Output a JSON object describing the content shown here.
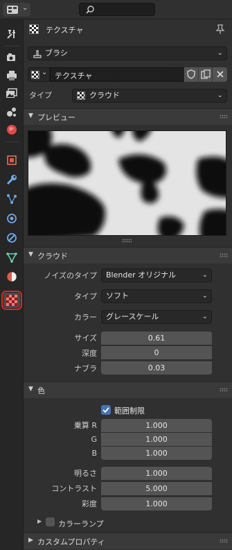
{
  "header": {
    "title": "テクスチャ"
  },
  "brush_selector": {
    "value": "ブラシ"
  },
  "texture_block": {
    "name": "テクスチャ"
  },
  "type_row": {
    "label": "タイプ",
    "value": "クラウド"
  },
  "preview_panel": {
    "title": "プレビュー"
  },
  "clouds_panel": {
    "title": "クラウド",
    "noise_basis": {
      "label": "ノイズのタイプ",
      "value": "Blender オリジナル"
    },
    "noise_type": {
      "label": "タイプ",
      "value": "ソフト"
    },
    "color": {
      "label": "カラー",
      "value": "グレースケール"
    },
    "size": {
      "label": "サイズ",
      "value": "0.61"
    },
    "depth": {
      "label": "深度",
      "value": "0"
    },
    "nabla": {
      "label": "ナブラ",
      "value": "0.03"
    }
  },
  "colors_panel": {
    "title": "色",
    "clamp": {
      "label": "範囲制限",
      "checked": true
    },
    "r": {
      "label": "乗算 R",
      "value": "1.000"
    },
    "g": {
      "label": "G",
      "value": "1.000"
    },
    "b": {
      "label": "B",
      "value": "1.000"
    },
    "brightness": {
      "label": "明るさ",
      "value": "1.000"
    },
    "contrast": {
      "label": "コントラスト",
      "value": "5.000"
    },
    "saturation": {
      "label": "彩度",
      "value": "1.000"
    },
    "color_ramp": {
      "label": "カラーランプ",
      "checked": false
    }
  },
  "custom_props_panel": {
    "title": "カスタムプロパティ"
  },
  "colors": {
    "accent": "#4772b3",
    "highlight_outline": "#e02424"
  }
}
